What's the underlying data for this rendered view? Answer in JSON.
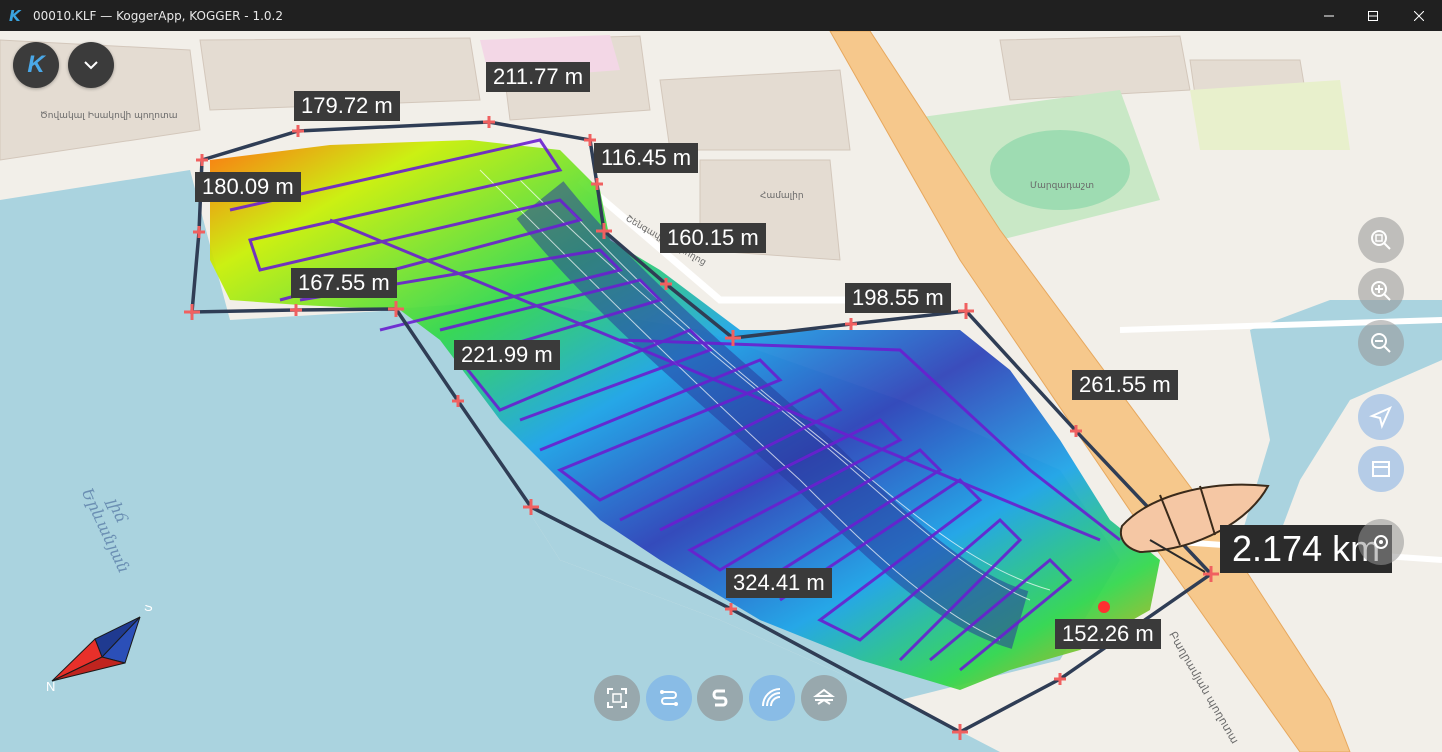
{
  "window": {
    "title": "00010.KLF — KoggerApp, KOGGER - 1.0.2",
    "app_icon": "K",
    "controls": [
      "minimize",
      "maximize",
      "close"
    ]
  },
  "toolbar_top": {
    "logo_letter": "K",
    "menu_icon": "chevron-down-icon"
  },
  "distance_labels": [
    "211.77 m",
    "179.72 m",
    "116.45 m",
    "180.09 m",
    "160.15 m",
    "167.55 m",
    "198.55 m",
    "221.99 m",
    "261.55 m",
    "324.41 m",
    "152.26 m"
  ],
  "total_distance": "2.174 km",
  "compass": {
    "north": "N",
    "south": "S"
  },
  "map_labels": {
    "lake_name_line1": "Երևանյան",
    "lake_name_line2": "լիճ",
    "street_1": "Ծովակալ Իսակովի պողոտա",
    "street_2": "Արաբկիր փողոց",
    "street_3": "Շենգավիթի փողոց",
    "street_4": "Բաղրամյան պողոտա",
    "poi_1": "Համալիր",
    "poi_2": "Մարզադաշտ"
  },
  "side_controls": [
    "zoom-fit-icon",
    "zoom-in-icon",
    "zoom-out-icon",
    "navigate-icon",
    "layers-icon",
    "settings-icon"
  ],
  "bottom_controls": [
    "frame-icon",
    "track-icon",
    "surface-icon",
    "contour-icon",
    "boat-icon"
  ],
  "colors": {
    "water": "#aad3df",
    "land": "#f2efe9",
    "track": "#6a1fd0",
    "boundary": "#2f3d55",
    "road": "#f6c88c",
    "label_bg": "#3a3a3a"
  }
}
